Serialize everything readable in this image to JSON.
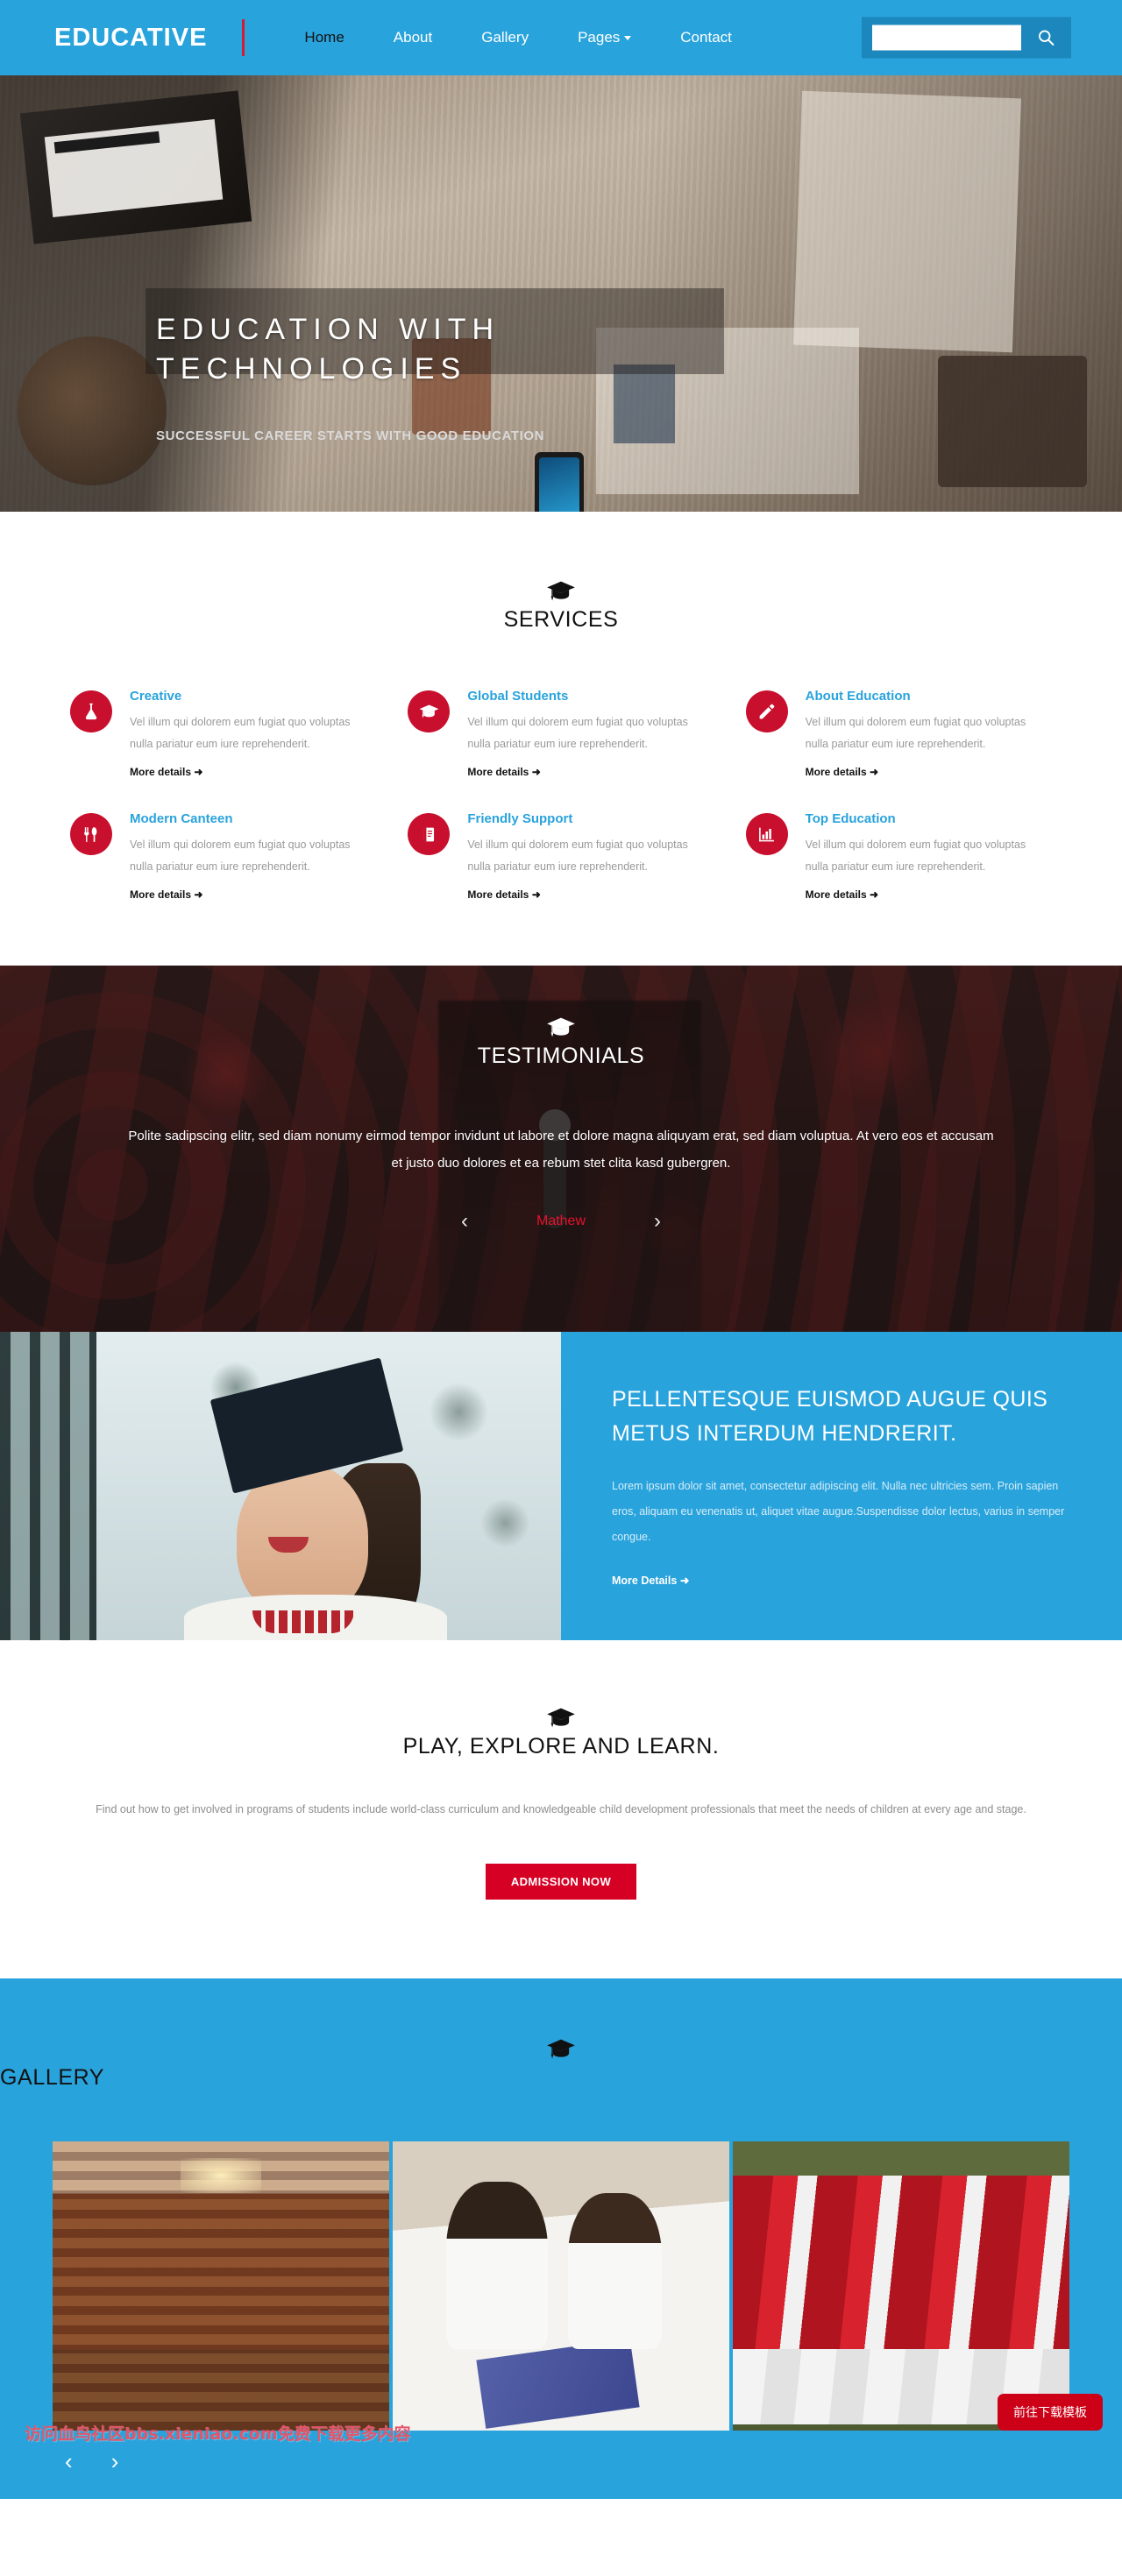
{
  "colors": {
    "brand_blue": "#29A3DC",
    "brand_blue_dark": "#1C87BC",
    "accent_red": "#C8102E",
    "button_red": "#D60024",
    "testimonial_author_red": "#E5122C",
    "body_gray": "#9a9a9a"
  },
  "header": {
    "logo": "EDUCATIVE",
    "nav": [
      {
        "label": "Home",
        "active": true,
        "icon": ""
      },
      {
        "label": "About",
        "active": false,
        "icon": ""
      },
      {
        "label": "Gallery",
        "active": false,
        "icon": ""
      },
      {
        "label": "Pages",
        "active": false,
        "icon": "chevron-down-icon"
      },
      {
        "label": "Contact",
        "active": false,
        "icon": ""
      }
    ],
    "search": {
      "value": "",
      "placeholder": "",
      "icon": "search-icon"
    }
  },
  "hero": {
    "title": "EDUCATION WITH TECHNOLOGIES",
    "subtitle": "SUCCESSFUL CAREER STARTS WITH GOOD EDUCATION"
  },
  "services": {
    "icon": "graduation-cap-icon",
    "title": "SERVICES",
    "items": [
      {
        "icon": "flask-icon",
        "title": "Creative",
        "text": "Vel illum qui dolorem eum fugiat quo voluptas nulla pariatur eum iure reprehenderit.",
        "more": "More details"
      },
      {
        "icon": "graduation-cap-icon",
        "title": "Global Students",
        "text": "Vel illum qui dolorem eum fugiat quo voluptas nulla pariatur eum iure reprehenderit.",
        "more": "More details"
      },
      {
        "icon": "pencil-icon",
        "title": "About Education",
        "text": "Vel illum qui dolorem eum fugiat quo voluptas nulla pariatur eum iure reprehenderit.",
        "more": "More details"
      },
      {
        "icon": "cutlery-icon",
        "title": "Modern Canteen",
        "text": "Vel illum qui dolorem eum fugiat quo voluptas nulla pariatur eum iure reprehenderit.",
        "more": "More details"
      },
      {
        "icon": "book-icon",
        "title": "Friendly Support",
        "text": "Vel illum qui dolorem eum fugiat quo voluptas nulla pariatur eum iure reprehenderit.",
        "more": "More details"
      },
      {
        "icon": "bar-chart-icon",
        "title": "Top Education",
        "text": "Vel illum qui dolorem eum fugiat quo voluptas nulla pariatur eum iure reprehenderit.",
        "more": "More details"
      }
    ]
  },
  "testimonials": {
    "icon": "graduation-cap-icon",
    "title": "TESTIMONIALS",
    "quote": "Polite sadipscing elitr, sed diam nonumy eirmod tempor invidunt ut labore et dolore magna aliquyam erat, sed diam voluptua. At vero eos et accusam et justo duo dolores et ea rebum stet clita kasd gubergren.",
    "author": "Mathew",
    "prev_arrow": "‹",
    "next_arrow": "›"
  },
  "feature": {
    "image_alt": "graduate-photo",
    "title": "PELLENTESQUE EUISMOD AUGUE QUIS METUS INTERDUM HENDRERIT.",
    "paragraph": "Lorem ipsum dolor sit amet, consectetur adipiscing elit. Nulla nec ultricies sem. Proin sapien eros, aliquam eu venenatis ut, aliquet vitae augue.Suspendisse dolor lectus, varius in semper congue.",
    "more": "More Details"
  },
  "cta": {
    "icon": "graduation-cap-icon",
    "title": "PLAY, EXPLORE AND LEARN.",
    "paragraph": "Find out how to get involved in programs of students include world-class curriculum and knowledgeable child development professionals that meet the needs of children at every age and stage.",
    "button": "ADMISSION NOW"
  },
  "gallery": {
    "icon": "graduation-cap-icon",
    "title": "GALLERY",
    "items": [
      {
        "alt": "library-interior"
      },
      {
        "alt": "two-students-reading"
      },
      {
        "alt": "football-team-huddle"
      }
    ],
    "prev_arrow": "‹",
    "next_arrow": "›"
  },
  "overlay": {
    "watermark": "访问血鸟社区bbs.xieniao.com免费下载更多内容",
    "download_button": "前往下载模板"
  }
}
